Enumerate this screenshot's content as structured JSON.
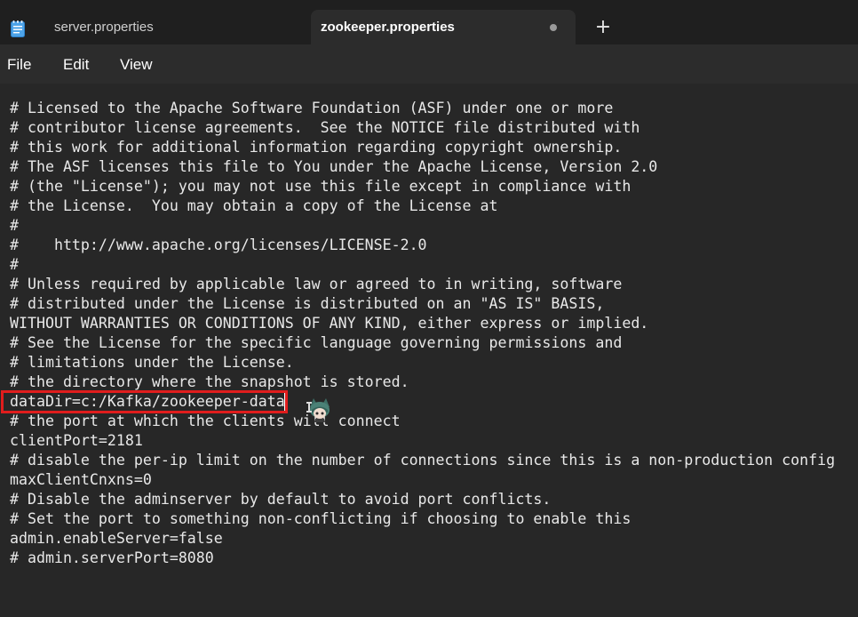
{
  "tabs": [
    {
      "label": "server.properties",
      "icon": "notepad-icon",
      "active": false
    },
    {
      "label": "zookeeper.properties",
      "active": true,
      "unsaved": true
    }
  ],
  "new_tab": {
    "label": "+"
  },
  "menu": {
    "items": [
      "File",
      "Edit",
      "View"
    ]
  },
  "editor": {
    "lines": [
      "# Licensed to the Apache Software Foundation (ASF) under one or more",
      "# contributor license agreements.  See the NOTICE file distributed with",
      "# this work for additional information regarding copyright ownership.",
      "# The ASF licenses this file to You under the Apache License, Version 2.0",
      "# (the \"License\"); you may not use this file except in compliance with",
      "# the License.  You may obtain a copy of the License at",
      "#",
      "#    http://www.apache.org/licenses/LICENSE-2.0",
      "#",
      "# Unless required by applicable law or agreed to in writing, software",
      "# distributed under the License is distributed on an \"AS IS\" BASIS,",
      "WITHOUT WARRANTIES OR CONDITIONS OF ANY KIND, either express or implied.",
      "# See the License for the specific language governing permissions and",
      "# limitations under the License.",
      "# the directory where the snapshot is stored.",
      "dataDir=c:/Kafka/zookeeper-data",
      "# the port at which the clients will connect",
      "clientPort=2181",
      "# disable the per-ip limit on the number of connections since this is a non-production config",
      "maxClientCnxns=0",
      "# Disable the adminserver by default to avoid port conflicts.",
      "# Set the port to something non-conflicting if choosing to enable this",
      "admin.enableServer=false",
      "# admin.serverPort=8080"
    ],
    "highlighted_line": 15
  },
  "colors": {
    "background": "#272727",
    "tabbar": "#1f1f1f",
    "active_tab": "#2c2c2c",
    "highlight_border": "#e01d1d",
    "text": "#e8e8e8"
  }
}
